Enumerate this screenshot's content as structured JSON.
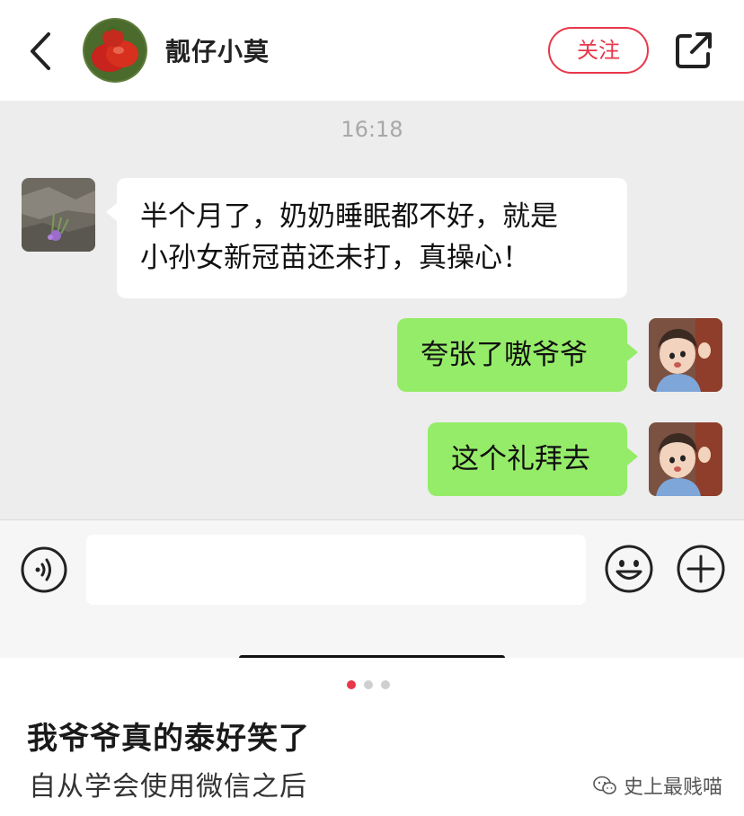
{
  "header": {
    "title": "靓仔小莫",
    "follow_label": "关注"
  },
  "chat": {
    "time": "16:18",
    "messages": [
      {
        "side": "left",
        "text_line1": "半个月了，奶奶睡眠都不好，就是",
        "text_line2": "小孙女新冠苗还未打，真操心！"
      },
      {
        "side": "right",
        "text": "夸张了嗷爷爷"
      },
      {
        "side": "right",
        "text": "这个礼拜去"
      }
    ]
  },
  "input_bar": {
    "icons": [
      "voice-icon",
      "emoji-icon",
      "plus-icon"
    ],
    "value": ""
  },
  "post": {
    "title": "我爷爷真的泰好笑了",
    "subtitle": "自从学会使用微信之后",
    "watermark": "史上最贱喵",
    "page_dots": 3,
    "active_dot": 0
  },
  "colors": {
    "accent": "#e8374a",
    "bubble_green": "#95ec69",
    "chat_bg": "#ededed"
  }
}
